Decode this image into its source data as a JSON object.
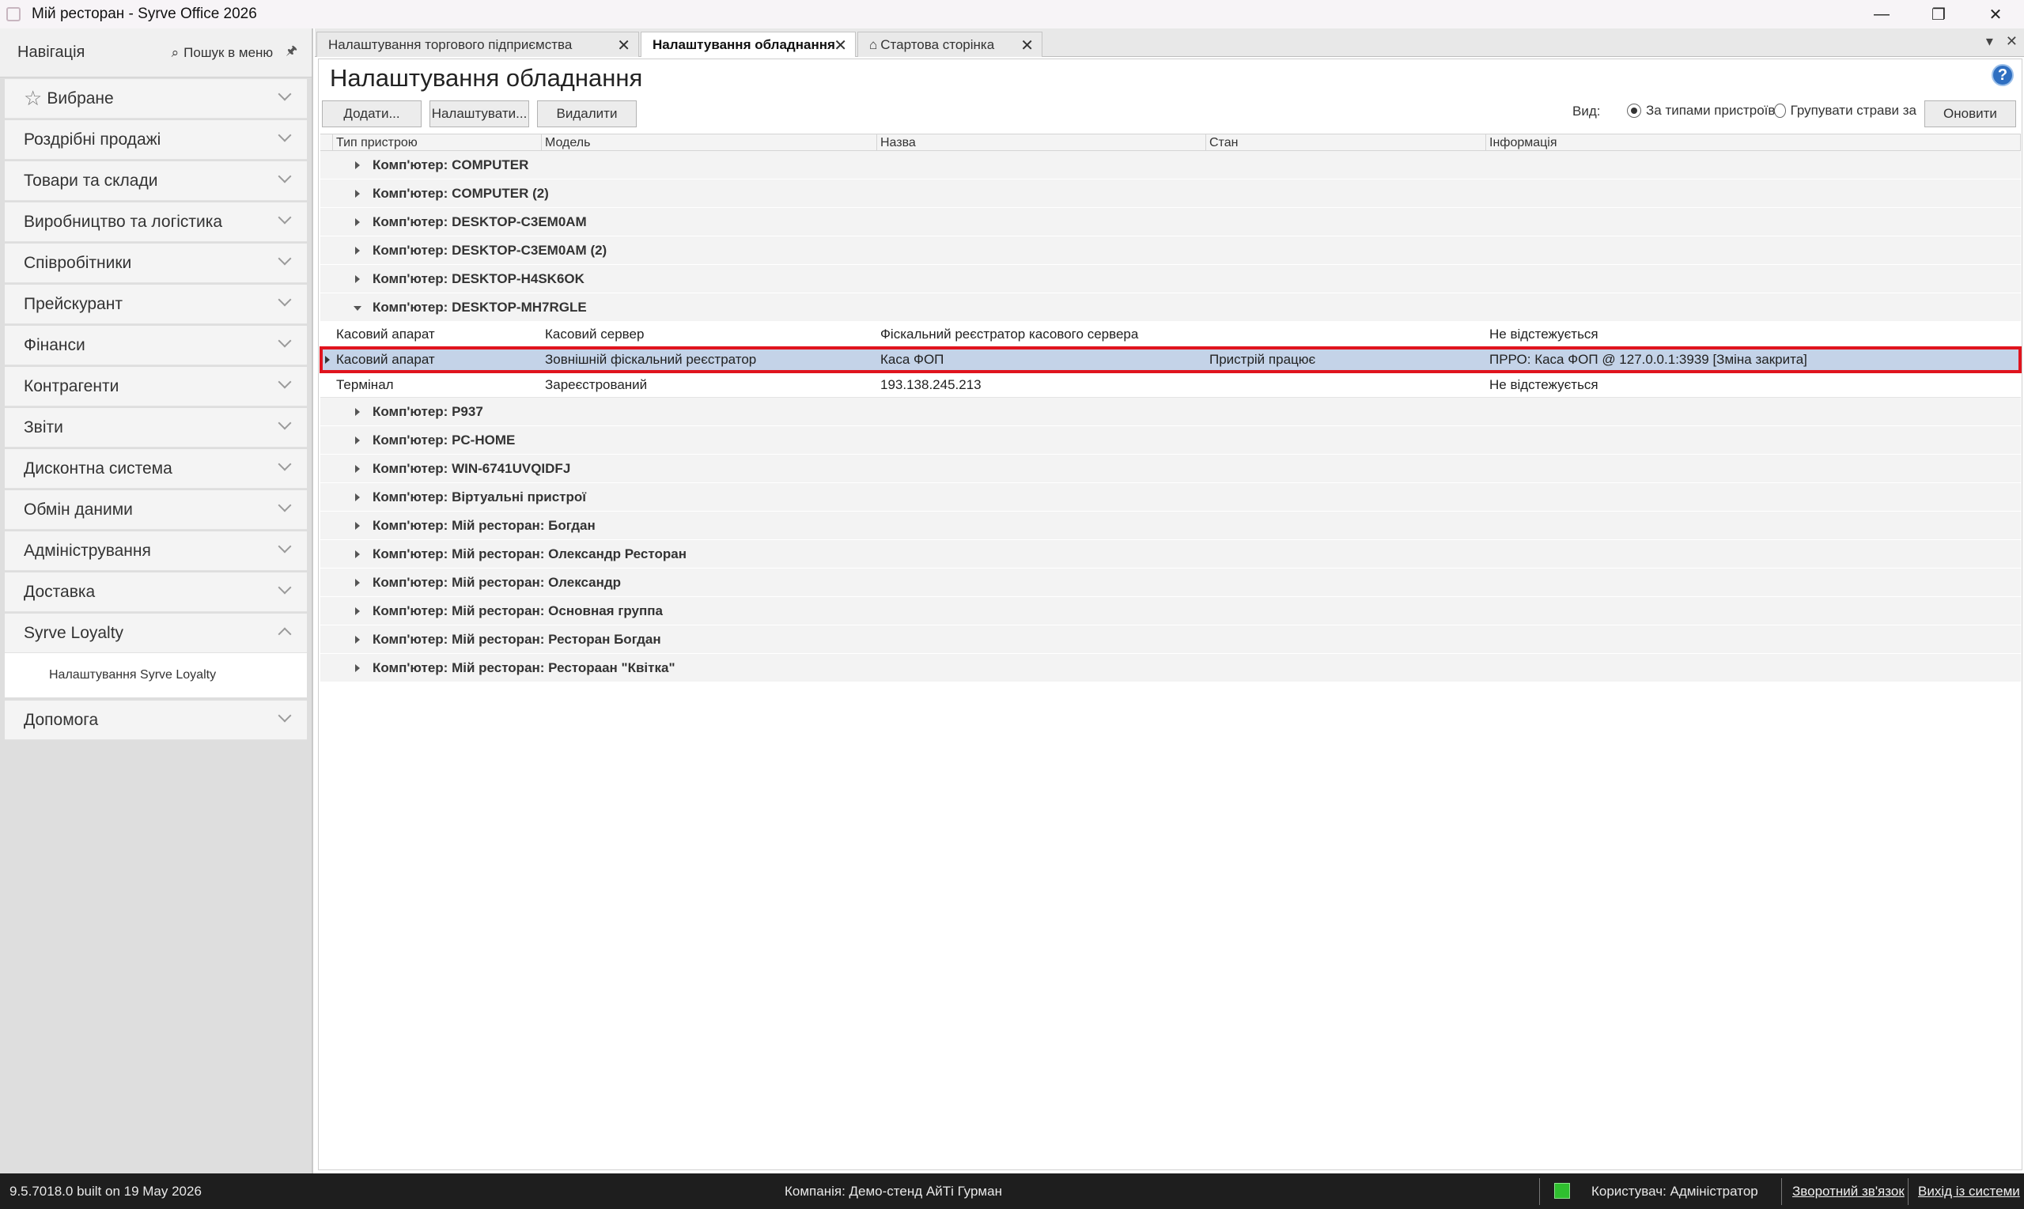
{
  "window": {
    "title": "Мій ресторан - Syrve Office 2026",
    "controls": {
      "minimize": "—",
      "restore": "❐",
      "close": "✕"
    }
  },
  "sidebar": {
    "header": "Навігація",
    "search_label": "Пошук в меню",
    "items": [
      {
        "label": "Вибране",
        "icon": "star-icon"
      },
      {
        "label": "Роздрібні продажі"
      },
      {
        "label": "Товари та склади"
      },
      {
        "label": "Виробництво та логістика"
      },
      {
        "label": "Співробітники"
      },
      {
        "label": "Прейскурант"
      },
      {
        "label": "Фінанси"
      },
      {
        "label": "Контрагенти"
      },
      {
        "label": "Звіти"
      },
      {
        "label": "Дисконтна система"
      },
      {
        "label": "Обмін даними"
      },
      {
        "label": "Адміністрування"
      },
      {
        "label": "Доставка"
      },
      {
        "label": "Syrve Loyalty",
        "expanded": true
      }
    ],
    "sub_items": [
      "Налаштування Syrve Loyalty"
    ],
    "last_item": "Допомога"
  },
  "tabs": [
    {
      "label": "Налаштування торгового підприємства",
      "active": false
    },
    {
      "label": "Налаштування обладнання",
      "active": true
    },
    {
      "label": "Стартова сторінка",
      "active": false,
      "icon": "home-icon"
    }
  ],
  "page": {
    "title": "Налаштування обладнання",
    "toolbar": {
      "add": "Додати...",
      "configure": "Налаштувати...",
      "delete": "Видалити"
    },
    "view": {
      "label": "Вид:",
      "option1": "За типами пристроїв",
      "option2": "Групувати страви за",
      "selected": "За типами пристроїв",
      "refresh": "Оновити"
    }
  },
  "grid": {
    "columns": [
      "Тип пристрою",
      "Модель",
      "Назва",
      "Стан",
      "Інформація"
    ],
    "groups_before": [
      "Комп'ютер: COMPUTER",
      "Комп'ютер: COMPUTER (2)",
      "Комп'ютер: DESKTOP-C3EM0AM",
      "Комп'ютер: DESKTOP-C3EM0AM (2)",
      "Комп'ютер: DESKTOP-H4SK6OK"
    ],
    "expanded_group": "Комп'ютер: DESKTOP-MH7RGLE",
    "rows": [
      {
        "type": "Касовий апарат",
        "model": "Касовий сервер",
        "name": "Фіскальний реєстратор касового сервера",
        "state": "",
        "info": "Не відстежується"
      },
      {
        "type": "Касовий апарат",
        "model": "Зовнішній фіскальний реєстратор",
        "name": "Каса ФОП",
        "state": "Пристрій працює",
        "info": "ПРРО: Каса ФОП @ 127.0.0.1:3939 [Зміна закрита]",
        "selected": true
      },
      {
        "type": "Термінал",
        "model": "Зареєстрований",
        "name": "193.138.245.213",
        "state": "",
        "info": "Не відстежується"
      }
    ],
    "groups_after": [
      "Комп'ютер: P937",
      "Комп'ютер: PC-HOME",
      "Комп'ютер: WIN-6741UVQIDFJ",
      "Комп'ютер: Віртуальні пристрої",
      "Комп'ютер: Мій ресторан: Богдан",
      "Комп'ютер: Мій ресторан: Олександр Ресторан",
      "Комп'ютер: Мій ресторан: Олександр",
      "Комп'ютер: Мій ресторан: Основная группа",
      "Комп'ютер: Мій ресторан: Ресторан Богдан",
      "Комп'ютер: Мій ресторан: Рестораан \"Квітка\""
    ]
  },
  "statusbar": {
    "version": "9.5.7018.0 built on 19 May 2026",
    "company": "Компанія: Демо-стенд АйТі Гурман",
    "user": "Користувач: Адміністратор",
    "feedback": "Зворотний зв'язок",
    "logout": "Вихід із системи"
  },
  "colors": {
    "selected_row": "#c4d3e8",
    "selection_outline": "#e0141e",
    "status_ok": "#2fbf2f"
  }
}
